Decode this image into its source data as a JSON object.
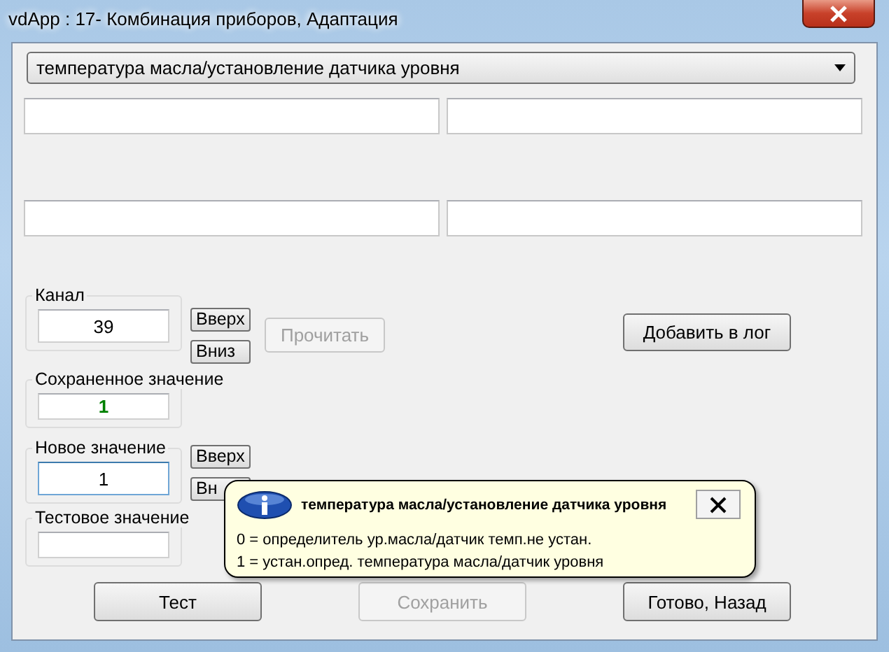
{
  "window": {
    "title": "vdApp : 17- Комбинация приборов, Адаптация"
  },
  "dropdown": {
    "value": "температура масла/установление датчика уровня"
  },
  "info_fields": [
    {
      "kind": "blank"
    },
    {
      "kind": "blank"
    },
    {
      "kind": "blank"
    },
    {
      "kind": "blank"
    }
  ],
  "channel": {
    "label": "Канал",
    "value": "39",
    "up": "Вверх",
    "down": "Вниз"
  },
  "read_button": {
    "label": "Прочитать",
    "disabled": true
  },
  "log_button": {
    "label": "Добавить в лог",
    "disabled": false
  },
  "saved_value": {
    "label": "Сохраненное значение",
    "value": "1"
  },
  "new_value": {
    "label": "Новое значение",
    "value": "1",
    "focused": true,
    "up": "Вверх",
    "down": "Вн"
  },
  "test_value": {
    "label": "Тестовое значение"
  },
  "buttons": [
    {
      "label": "Тест",
      "disabled": false
    },
    {
      "label": "Сохранить",
      "disabled": true
    },
    {
      "label": "Готово, Назад",
      "disabled": false
    }
  ],
  "tooltip": {
    "title": "температура масла/установление датчика уровня",
    "lines": [
      "0 = определитель ур.масла/датчик темп.не устан.",
      "1 = устан.опред. температура масла/датчик уровня"
    ]
  }
}
